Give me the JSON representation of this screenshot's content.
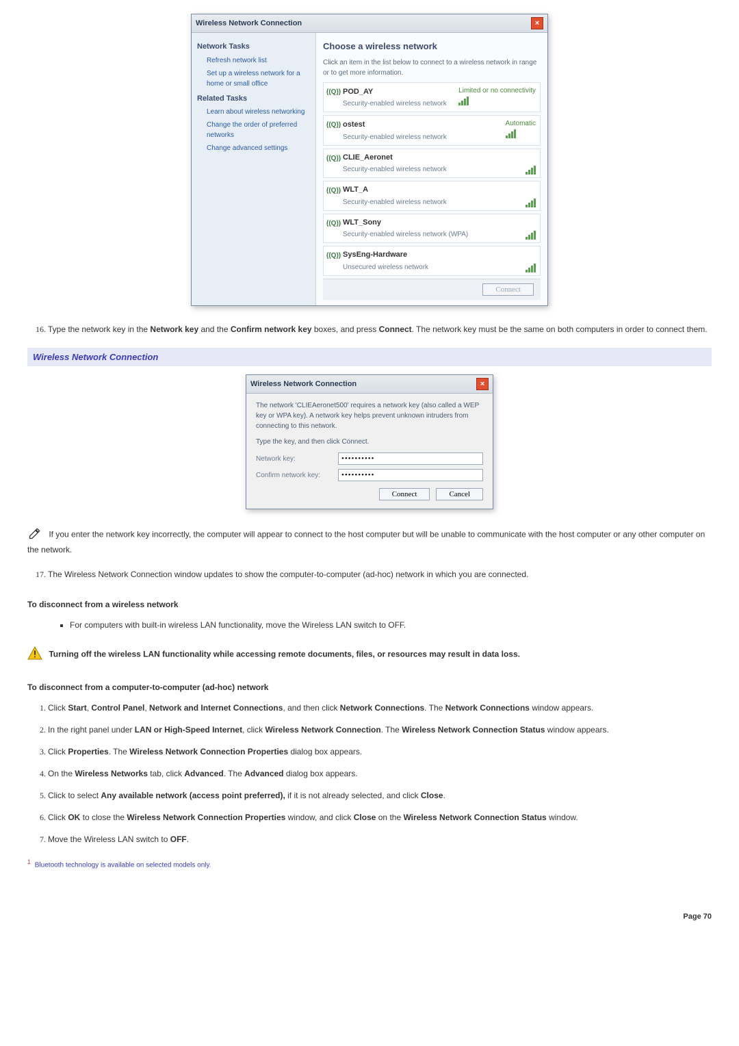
{
  "dialog1": {
    "title": "Wireless Network Connection",
    "left": {
      "group1": "Network Tasks",
      "link1": "Refresh network list",
      "link2": "Set up a wireless network for a home or small office",
      "group2": "Related Tasks",
      "link3": "Learn about wireless networking",
      "link4": "Change the order of preferred networks",
      "link5": "Change advanced settings"
    },
    "right": {
      "heading": "Choose a wireless network",
      "hint": "Click an item in the list below to connect to a wireless network in range or to get more information.",
      "networks": [
        {
          "name": "POD_AY",
          "sub": "Security-enabled wireless network",
          "right": "Limited or no connectivity"
        },
        {
          "name": "ostest",
          "sub": "Security-enabled wireless network",
          "right": "Automatic"
        },
        {
          "name": "CLIE_Aeronet",
          "sub": "Security-enabled wireless network",
          "right": ""
        },
        {
          "name": "WLT_A",
          "sub": "Security-enabled wireless network",
          "right": ""
        },
        {
          "name": "WLT_Sony",
          "sub": "Security-enabled wireless network (WPA)",
          "right": ""
        },
        {
          "name": "SysEng-Hardware",
          "sub": "Unsecured wireless network",
          "right": ""
        }
      ],
      "connect": "Connect"
    }
  },
  "step16": {
    "pre": "Type the network key in the ",
    "b1": "Network key",
    "mid1": " and the ",
    "b2": "Confirm network key",
    "mid2": " boxes, and press ",
    "b3": "Connect",
    "post": ". The network key must be the same on both computers in order to connect them."
  },
  "section_header": "Wireless Network Connection",
  "dialog2": {
    "title": "Wireless Network Connection",
    "msg1": "The network 'CLIEAeronet500' requires a network key (also called a WEP key or WPA key). A network key helps prevent unknown intruders from connecting to this network.",
    "msg2": "Type the key, and then click Connect.",
    "label1": "Network key:",
    "label2": "Confirm network key:",
    "value": "••••••••••",
    "btn_connect": "Connect",
    "btn_cancel": "Cancel"
  },
  "note_text": " If you enter the network key incorrectly, the computer will appear to connect to the host computer but will be unable to communicate with the host computer or any other computer on the network.",
  "step17": "The Wireless Network Connection window updates to show the computer-to-computer (ad-hoc) network in which you are connected.",
  "subhead1": "To disconnect from a wireless network",
  "bullet1": "For computers with built-in wireless LAN functionality, move the Wireless LAN switch to OFF.",
  "warn_text": "Turning off the wireless LAN functionality while accessing remote documents, files, or resources may result in data loss.",
  "subhead2": "To disconnect from a computer-to-computer (ad-hoc) network",
  "adhoc_steps": {
    "s1": {
      "pre": "Click ",
      "b1": "Start",
      "m1": ", ",
      "b2": "Control Panel",
      "m2": ", ",
      "b3": "Network and Internet Connections",
      "m3": ", and then click ",
      "b4": "Network Connections",
      "m4": ". The ",
      "b5": "Network Connections",
      "post": " window appears."
    },
    "s2": {
      "pre": "In the right panel under ",
      "b1": "LAN or High-Speed Internet",
      "m1": ", click ",
      "b2": "Wireless Network Connection",
      "m2": ". The ",
      "b3": "Wireless Network Connection Status",
      "post": " window appears."
    },
    "s3": {
      "pre": "Click ",
      "b1": "Properties",
      "m1": ". The ",
      "b2": "Wireless Network Connection Properties",
      "post": " dialog box appears."
    },
    "s4": {
      "pre": "On the ",
      "b1": "Wireless Networks",
      "m1": " tab, click ",
      "b2": "Advanced",
      "m2": ". The ",
      "b3": "Advanced",
      "post": " dialog box appears."
    },
    "s5": {
      "pre": "Click to select ",
      "b1": "Any available network (access point preferred),",
      "m1": " if it is not already selected, and click ",
      "b2": "Close",
      "post": "."
    },
    "s6": {
      "pre": "Click ",
      "b1": "OK",
      "m1": " to close the ",
      "b2": "Wireless Network Connection Properties",
      "m2": " window, and click ",
      "b3": "Close",
      "m3": " on the ",
      "b4": "Wireless Network Connection Status",
      "post": " window."
    },
    "s7": {
      "pre": "Move the Wireless LAN switch to ",
      "b1": "OFF",
      "post": "."
    }
  },
  "footnote_marker": "1",
  "footnote_text": " Bluetooth technology is available on selected models only.",
  "page_number": "Page 70"
}
